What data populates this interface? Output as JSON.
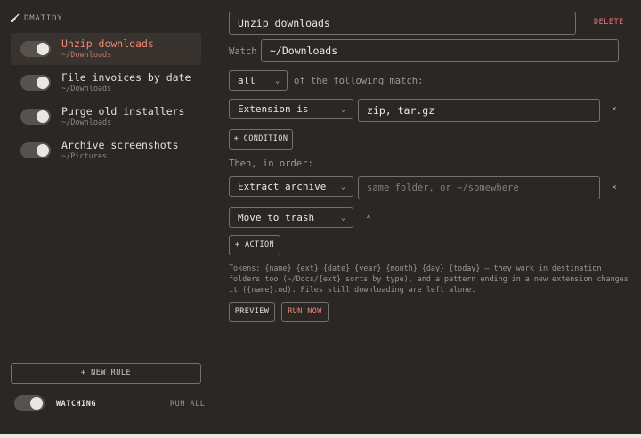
{
  "app": {
    "brand": "DMATIDY"
  },
  "sidebar": {
    "rules": [
      {
        "name": "Unzip downloads",
        "path": "~/Downloads",
        "enabled": true,
        "active": true
      },
      {
        "name": "File invoices by date",
        "path": "~/Downloads",
        "enabled": true,
        "active": false
      },
      {
        "name": "Purge old installers",
        "path": "~/Downloads",
        "enabled": true,
        "active": false
      },
      {
        "name": "Archive screenshots",
        "path": "~/Pictures",
        "enabled": true,
        "active": false
      }
    ],
    "new_rule_label": "+ NEW RULE",
    "watching_label": "WATCHING",
    "watching_enabled": true,
    "run_all_label": "RUN ALL"
  },
  "editor": {
    "rule_name": "Unzip downloads",
    "delete_label": "DELETE",
    "watch_label": "Watch",
    "watch_path": "~/Downloads",
    "match_mode": "all",
    "match_suffix": "of the following match:",
    "conditions": [
      {
        "field": "Extension is",
        "value": "zip, tar.gz"
      }
    ],
    "add_condition_label": "+ CONDITION",
    "then_label": "Then, in order:",
    "actions": [
      {
        "type": "Extract archive",
        "placeholder": "same folder, or ~/somewhere"
      },
      {
        "type": "Move to trash"
      }
    ],
    "add_action_label": "+ ACTION",
    "help_text": "Tokens: {name} {ext} {date} {year} {month} {day} {today} — they work in destination folders too (~/Docs/{ext} sorts by type), and a pattern ending in a new extension changes it ({name}.md). Files still downloading are left alone.",
    "preview_label": "PREVIEW",
    "run_now_label": "RUN NOW",
    "remove_glyph": "×",
    "chevron_glyph": "⌄"
  },
  "colors": {
    "background": "#2b2725",
    "accent": "#ee8a73",
    "danger": "#ee6f80",
    "border": "#77716c"
  }
}
